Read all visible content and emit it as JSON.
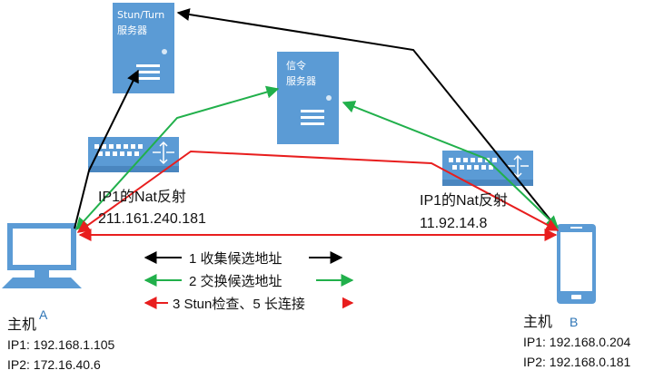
{
  "stun_server": {
    "line1": "Stun/Turn",
    "line2": "服务器"
  },
  "signal_server": {
    "line1": "信令",
    "line2": "服务器"
  },
  "nat_a": {
    "label": "IP1的Nat反射",
    "ip": "211.161.240.181"
  },
  "nat_b": {
    "label": "IP1的Nat反射",
    "ip": "11.92.14.8"
  },
  "host_a": {
    "title": "主机",
    "suffix": "A",
    "ip1": "IP1: 192.168.1.105",
    "ip2": "IP2: 172.16.40.6"
  },
  "host_b": {
    "title": "主机",
    "suffix": "B",
    "ip1": "IP1: 192.168.0.204",
    "ip2": "IP2: 192.168.0.181"
  },
  "legend": {
    "item1": "1 收集候选地址",
    "item2": "2 交换候选地址",
    "item3": "3 Stun检查、5 长连接"
  },
  "colors": {
    "device_blue": "#5b9bd5",
    "device_dark": "#4a86bf",
    "black": "#000000",
    "green": "#21b04b",
    "red": "#e81e1e"
  }
}
